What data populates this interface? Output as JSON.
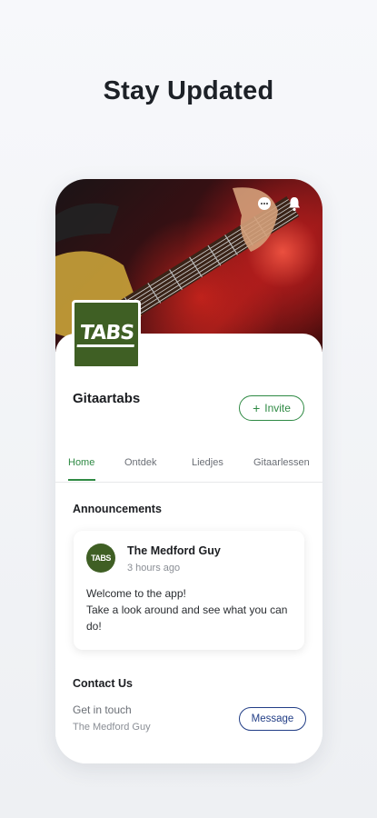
{
  "headline": "Stay Updated",
  "group": {
    "name": "Gitaartabs",
    "logo_text": "TABS",
    "invite_label": "Invite",
    "invite_icon": "plus-icon"
  },
  "hero_icons": [
    "chat-icon",
    "bell-icon"
  ],
  "tabs": [
    {
      "label": "Home",
      "active": true
    },
    {
      "label": "Ontdek"
    },
    {
      "label": "Liedjes"
    },
    {
      "label": "Gitaarlessen"
    }
  ],
  "announcements": {
    "title": "Announcements",
    "post": {
      "author": "The Medford Guy",
      "time": "3 hours ago",
      "avatar_text": "TABS",
      "line1": "Welcome to the app!",
      "line2": "Take a look around and see what you can do!"
    }
  },
  "contact": {
    "title": "Contact Us",
    "line1": "Get in touch",
    "line2": "The Medford Guy",
    "message_label": "Message"
  },
  "colors": {
    "accent": "#2f8a44",
    "message_btn": "#223e86",
    "logo_bg": "#3f5f24"
  }
}
